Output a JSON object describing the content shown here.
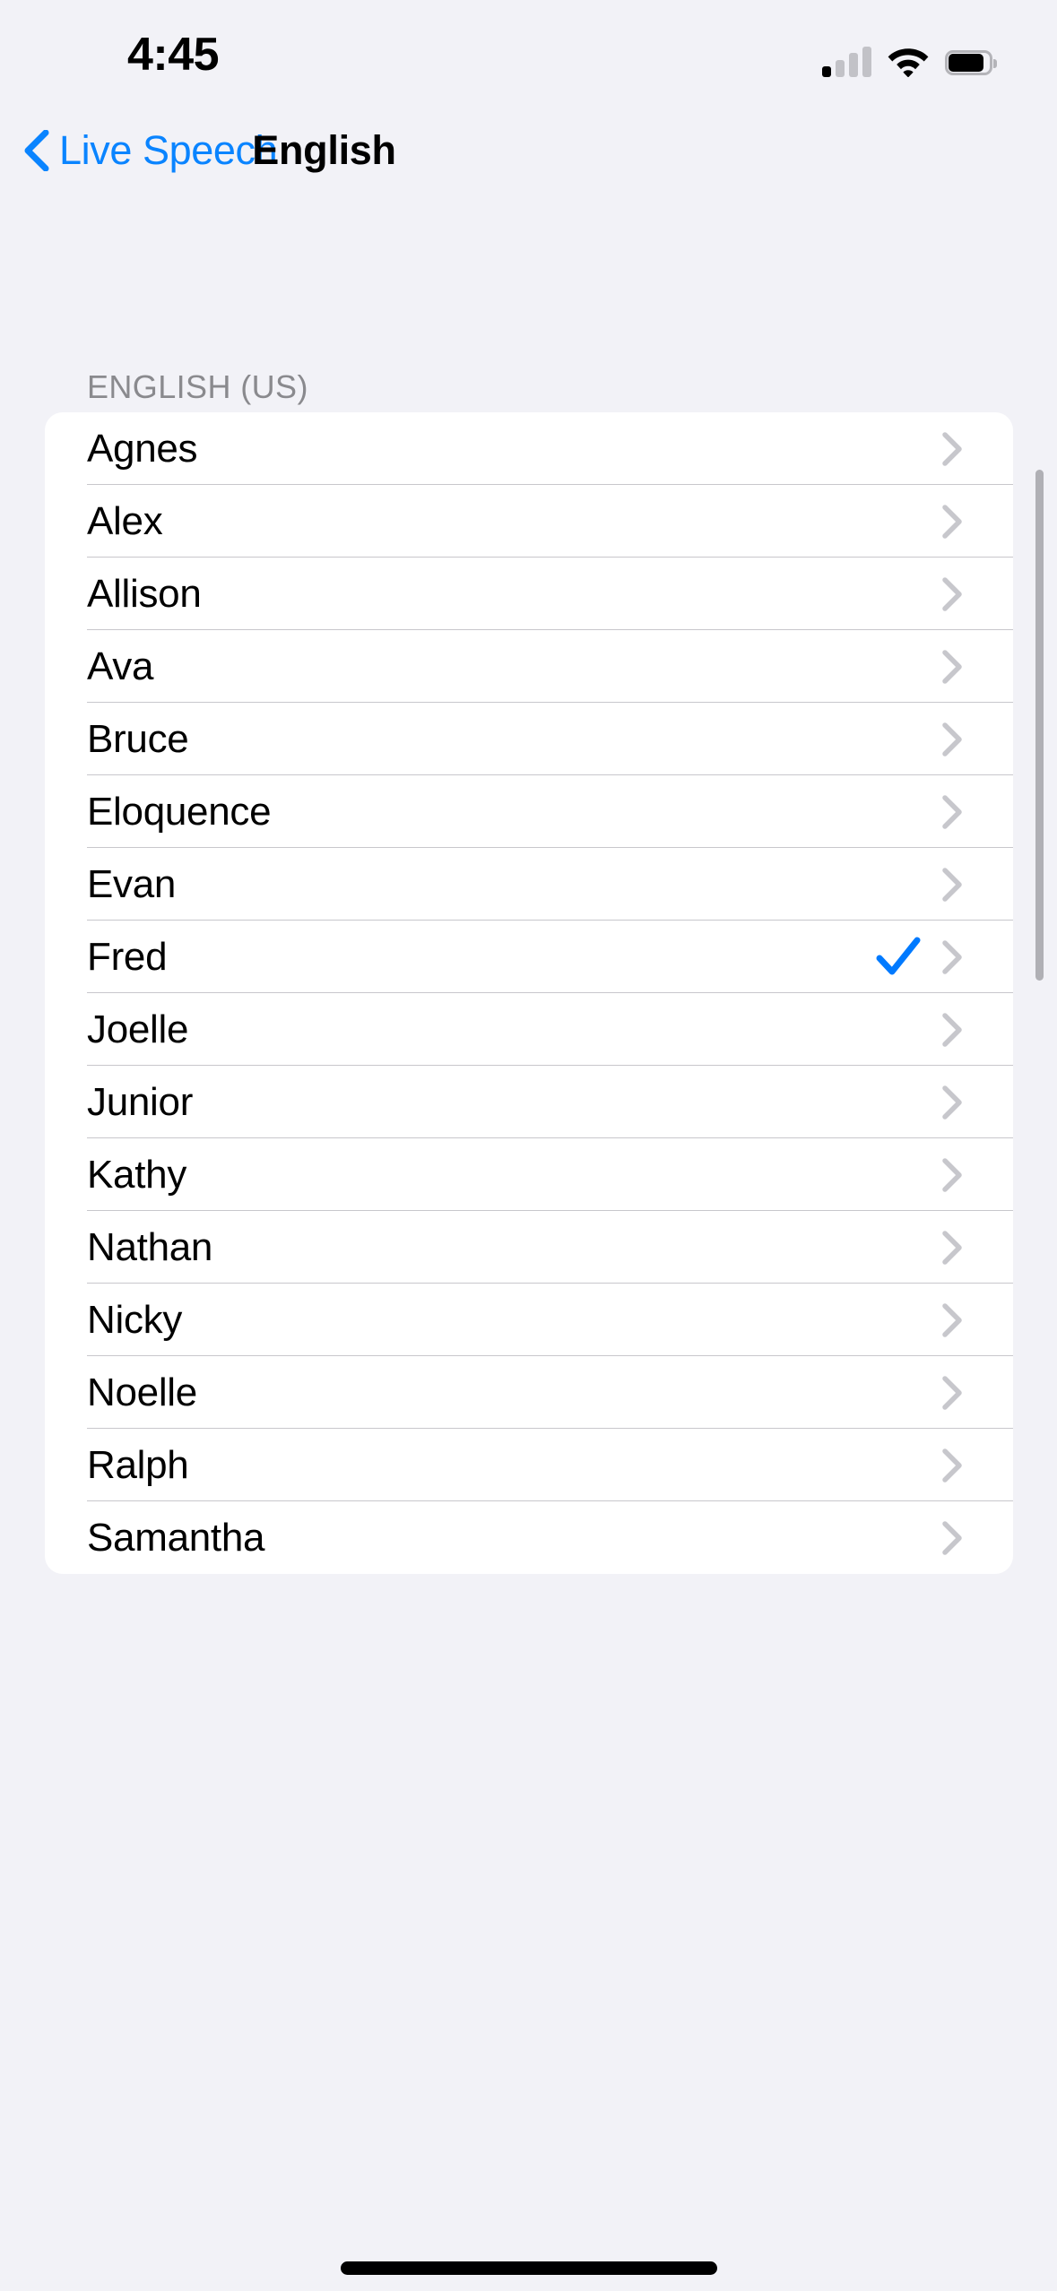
{
  "status_bar": {
    "time": "4:45",
    "cellular_icon": "cellular-signal-icon",
    "wifi_icon": "wifi-icon",
    "battery_icon": "battery-icon"
  },
  "nav_bar": {
    "back_label": "Live Speech",
    "back_icon": "chevron-left-icon",
    "title": "English"
  },
  "colors": {
    "accent": "#0A84FF",
    "checkmark": "#007AFF",
    "background": "#F2F2F7",
    "card": "#FFFFFF",
    "separator": "#C8C7CC",
    "header_text": "#8A8A8E",
    "chevron": "#C7C7CC"
  },
  "section": {
    "header": "ENGLISH (US)"
  },
  "voices": [
    {
      "name": "Agnes",
      "selected": false,
      "chevron": "chevron-right-icon"
    },
    {
      "name": "Alex",
      "selected": false,
      "chevron": "chevron-right-icon"
    },
    {
      "name": "Allison",
      "selected": false,
      "chevron": "chevron-right-icon"
    },
    {
      "name": "Ava",
      "selected": false,
      "chevron": "chevron-right-icon"
    },
    {
      "name": "Bruce",
      "selected": false,
      "chevron": "chevron-right-icon"
    },
    {
      "name": "Eloquence",
      "selected": false,
      "chevron": "chevron-right-icon"
    },
    {
      "name": "Evan",
      "selected": false,
      "chevron": "chevron-right-icon"
    },
    {
      "name": "Fred",
      "selected": true,
      "chevron": "chevron-right-icon"
    },
    {
      "name": "Joelle",
      "selected": false,
      "chevron": "chevron-right-icon"
    },
    {
      "name": "Junior",
      "selected": false,
      "chevron": "chevron-right-icon"
    },
    {
      "name": "Kathy",
      "selected": false,
      "chevron": "chevron-right-icon"
    },
    {
      "name": "Nathan",
      "selected": false,
      "chevron": "chevron-right-icon"
    },
    {
      "name": "Nicky",
      "selected": false,
      "chevron": "chevron-right-icon"
    },
    {
      "name": "Noelle",
      "selected": false,
      "chevron": "chevron-right-icon"
    },
    {
      "name": "Ralph",
      "selected": false,
      "chevron": "chevron-right-icon"
    },
    {
      "name": "Samantha",
      "selected": false,
      "chevron": "chevron-right-icon"
    }
  ]
}
